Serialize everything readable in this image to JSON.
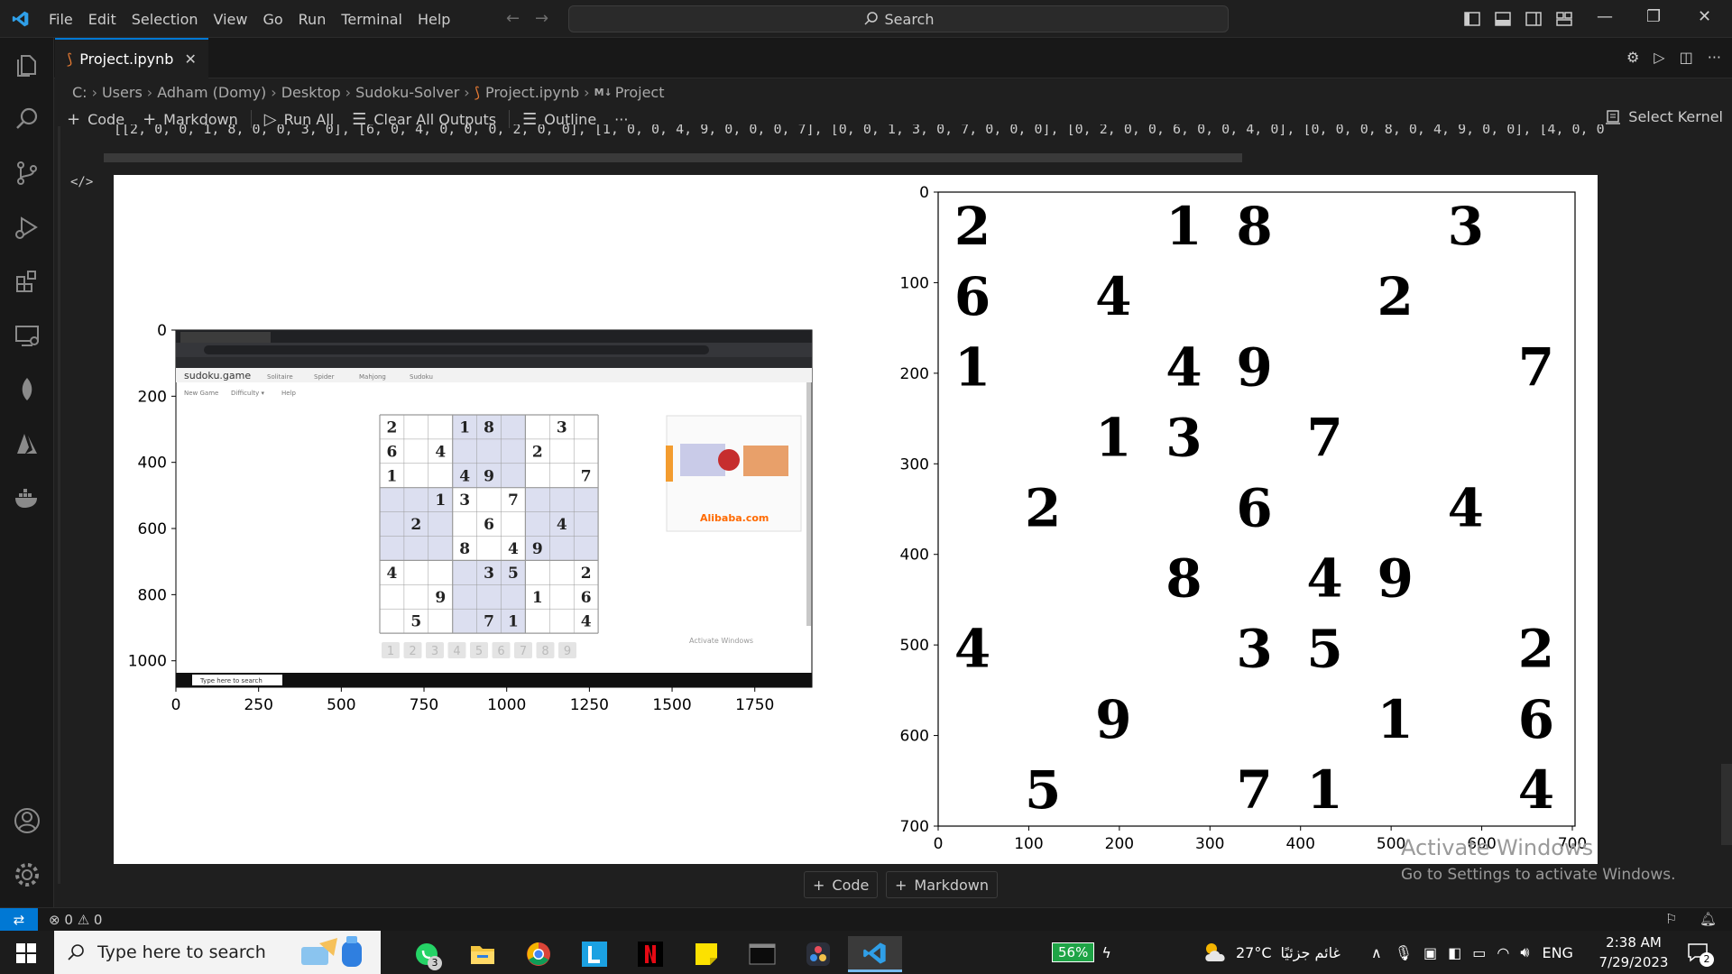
{
  "titlebar": {
    "menu": [
      "File",
      "Edit",
      "Selection",
      "View",
      "Go",
      "Run",
      "Terminal",
      "Help"
    ],
    "search_placeholder": "Search"
  },
  "tab": {
    "label": "Project.ipynb",
    "close": "✕"
  },
  "breadcrumb": [
    "C:",
    "Users",
    "Adham (Domy)",
    "Desktop",
    "Sudoku-Solver",
    "Project.ipynb",
    "Project"
  ],
  "toolbar": {
    "code": "Code",
    "markdown": "Markdown",
    "run_all": "Run All",
    "clear_outputs": "Clear All Outputs",
    "outline": "Outline",
    "more": "···",
    "select_kernel": "Select Kernel"
  },
  "cell": {
    "scrolled_output": "[[2, 0, 0, 1, 8, 0, 0, 3, 0], [6, 0, 4, 0, 0, 0, 2, 0, 0], [1, 0, 0, 4, 9, 0, 0, 0, 7], [0, 0, 1, 3, 0, 7, 0, 0, 0], [0, 2, 0, 0, 6, 0, 0, 4, 0], [0, 0, 0, 8, 0, 4, 9, 0, 0], [4, 0, 0",
    "code_icon": "</>"
  },
  "left_plot": {
    "yticks": [
      "0",
      "200",
      "400",
      "600",
      "800",
      "1000"
    ],
    "xticks": [
      "0",
      "250",
      "500",
      "750",
      "1000",
      "1250",
      "1500",
      "1750"
    ],
    "screenshot": {
      "site": "sudoku.game",
      "nav_tabs": [
        "Solitaire",
        "Spider",
        "Mahjong",
        "Sudoku"
      ],
      "menu": [
        "New Game",
        "Difficulty ▾",
        "Help"
      ],
      "ad_brand": "Alibaba.com",
      "taskbar_search": "Type here to search",
      "watermark": "Activate Windows",
      "numpad": [
        "1",
        "2",
        "3",
        "4",
        "5",
        "6",
        "7",
        "8",
        "9"
      ]
    }
  },
  "right_plot": {
    "yticks": [
      "0",
      "100",
      "200",
      "300",
      "400",
      "500",
      "600",
      "700"
    ],
    "xticks": [
      "0",
      "100",
      "200",
      "300",
      "400",
      "500",
      "600",
      "700"
    ]
  },
  "sudoku_grid": [
    [
      2,
      0,
      0,
      1,
      8,
      0,
      0,
      3,
      0
    ],
    [
      6,
      0,
      4,
      0,
      0,
      0,
      2,
      0,
      0
    ],
    [
      1,
      0,
      0,
      4,
      9,
      0,
      0,
      0,
      7
    ],
    [
      0,
      0,
      1,
      3,
      0,
      7,
      0,
      0,
      0
    ],
    [
      0,
      2,
      0,
      0,
      6,
      0,
      0,
      4,
      0
    ],
    [
      0,
      0,
      0,
      8,
      0,
      4,
      9,
      0,
      0
    ],
    [
      4,
      0,
      0,
      0,
      3,
      5,
      0,
      0,
      2
    ],
    [
      0,
      0,
      9,
      0,
      0,
      0,
      1,
      0,
      6
    ],
    [
      0,
      5,
      0,
      0,
      7,
      1,
      0,
      0,
      4
    ]
  ],
  "add_cell": {
    "code": "Code",
    "markdown": "Markdown"
  },
  "watermark": {
    "line1": "Activate Windows",
    "line2": "Go to Settings to activate Windows."
  },
  "statusbar": {
    "errors": "0",
    "warnings": "0"
  },
  "taskbar": {
    "search_placeholder": "Type here to search",
    "whatsapp_badge": "3",
    "battery": "56%",
    "weather_temp": "27°C",
    "weather_desc": "غائم جزئيًا",
    "language": "ENG",
    "time": "2:38 AM",
    "date": "7/29/2023",
    "notifications": "2"
  }
}
